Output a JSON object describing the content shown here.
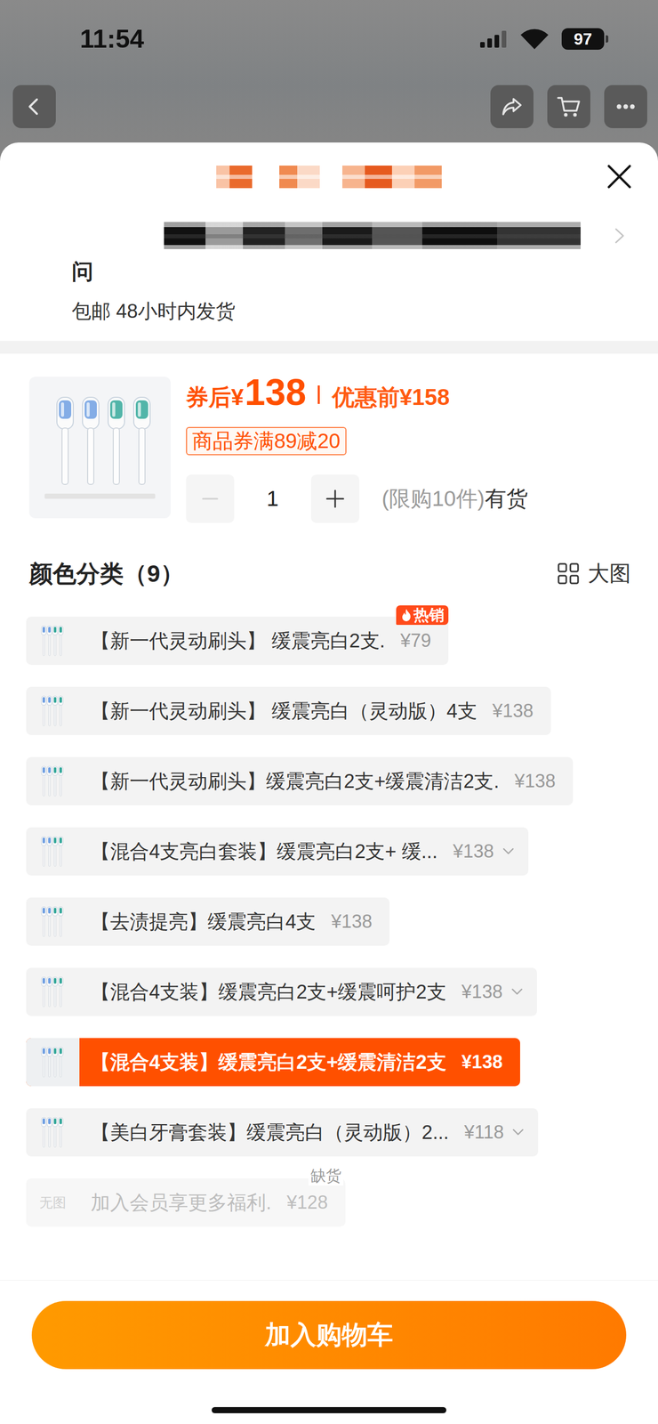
{
  "status_bar": {
    "time": "11:54",
    "battery": "97"
  },
  "sheet": {
    "question": "问",
    "shipping": "包邮 48小时内发货",
    "product": {
      "price_label": "券后",
      "currency": "¥",
      "price": "138",
      "original_label": "优惠前",
      "original_price": "¥158",
      "coupon": "商品券满89减20",
      "quantity": "1",
      "decrement_disabled": true,
      "limit": "(限购10件)",
      "stock": "有货"
    },
    "options_title": "颜色分类（9）",
    "large_view": "大图",
    "options": [
      {
        "label": "【新一代灵动刷头】 缓震亮白2支.",
        "price": "¥79",
        "selected": false,
        "disabled": false,
        "expandable": false,
        "badge": "热销",
        "stock_note": null,
        "thumb_text": null
      },
      {
        "label": "【新一代灵动刷头】 缓震亮白（灵动版）4支",
        "price": "¥138",
        "selected": false,
        "disabled": false,
        "expandable": false,
        "badge": null,
        "stock_note": null,
        "thumb_text": null
      },
      {
        "label": "【新一代灵动刷头】缓震亮白2支+缓震清洁2支.",
        "price": "¥138",
        "selected": false,
        "disabled": false,
        "expandable": false,
        "badge": null,
        "stock_note": null,
        "thumb_text": null
      },
      {
        "label": "【混合4支亮白套装】缓震亮白2支+ 缓...",
        "price": "¥138",
        "selected": false,
        "disabled": false,
        "expandable": true,
        "badge": null,
        "stock_note": null,
        "thumb_text": null
      },
      {
        "label": "【去渍提亮】缓震亮白4支",
        "price": "¥138",
        "selected": false,
        "disabled": false,
        "expandable": false,
        "badge": null,
        "stock_note": null,
        "thumb_text": null
      },
      {
        "label": "【混合4支装】缓震亮白2支+缓震呵护2支",
        "price": "¥138",
        "selected": false,
        "disabled": false,
        "expandable": true,
        "badge": null,
        "stock_note": null,
        "thumb_text": null
      },
      {
        "label": "【混合4支装】缓震亮白2支+缓震清洁2支",
        "price": "¥138",
        "selected": true,
        "disabled": false,
        "expandable": false,
        "badge": null,
        "stock_note": null,
        "thumb_text": null
      },
      {
        "label": "【美白牙膏套装】缓震亮白（灵动版）2...",
        "price": "¥118",
        "selected": false,
        "disabled": false,
        "expandable": true,
        "badge": null,
        "stock_note": null,
        "thumb_text": null
      },
      {
        "label": "加入会员享更多福利.",
        "price": "¥128",
        "selected": false,
        "disabled": true,
        "expandable": false,
        "badge": null,
        "stock_note": "缺货",
        "thumb_text": "无图"
      }
    ],
    "button": "加入购物车"
  }
}
